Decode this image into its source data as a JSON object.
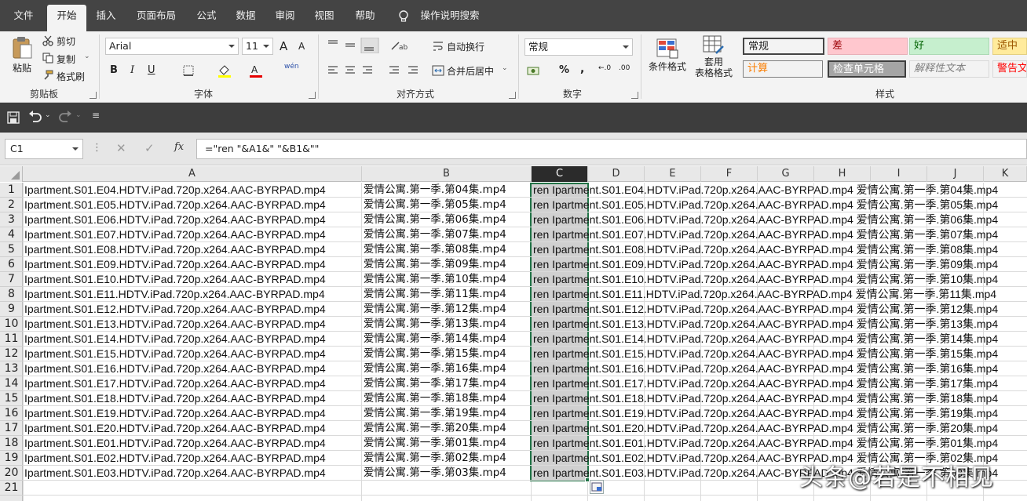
{
  "menu": {
    "tabs": [
      {
        "label": "文件",
        "x": 0
      },
      {
        "label": "开始",
        "x": 0
      },
      {
        "label": "插入",
        "x": 0
      },
      {
        "label": "页面布局",
        "x": 0
      },
      {
        "label": "公式",
        "x": 0
      },
      {
        "label": "数据",
        "x": 0
      },
      {
        "label": "审阅",
        "x": 0
      },
      {
        "label": "视图",
        "x": 0
      },
      {
        "label": "帮助",
        "x": 0
      }
    ],
    "active_tab": "开始",
    "tell_me": "操作说明搜索"
  },
  "ribbon": {
    "clipboard": {
      "paste": "粘贴",
      "cut": "剪切",
      "copy": "复制",
      "format_painter": "格式刷",
      "group_label": "剪贴板"
    },
    "font": {
      "font_name": "Arial",
      "font_size": "11",
      "bold": "B",
      "italic": "I",
      "underline": "U",
      "group_label": "字体",
      "phonetic": "wén",
      "grow": "A",
      "shrink": "A"
    },
    "alignment": {
      "wrap_text": "自动换行",
      "merge_center": "合并后居中",
      "group_label": "对齐方式"
    },
    "number": {
      "format": "常规",
      "percent": "%",
      "comma": ",",
      "inc_decimal": "←.0",
      "dec_decimal": ".00",
      "group_label": "数字"
    },
    "styles": {
      "conditional_format": "条件格式",
      "table_format_1": "套用",
      "table_format_2": "表格格式",
      "group_label": "样式",
      "cells": [
        {
          "label": "常规",
          "bg": "#ffffff",
          "color": "#111111"
        },
        {
          "label": "差",
          "bg": "#ffc7ce",
          "color": "#9c0006"
        },
        {
          "label": "好",
          "bg": "#c6efce",
          "color": "#006100"
        },
        {
          "label": "适中",
          "bg": "#ffeb9c",
          "color": "#9c5700"
        },
        {
          "label": "计算",
          "bg": "#f2f2f2",
          "color": "#fa7d00"
        },
        {
          "label": "检查单元格",
          "bg": "#a5a5a5",
          "color": "#ffffff"
        },
        {
          "label": "解释性文本",
          "bg": "#ffffff",
          "color": "#7f7f7f"
        },
        {
          "label": "警告文",
          "bg": "#ffffff",
          "color": "#ff0000"
        }
      ]
    }
  },
  "formula_bar": {
    "name_box": "C1",
    "fx": "fx",
    "formula": "=\"ren \"&A1&\" \"&B1&\"\""
  },
  "grid": {
    "columns": [
      "A",
      "B",
      "C",
      "D",
      "E",
      "F",
      "G",
      "H",
      "I",
      "J",
      "K"
    ],
    "selected_column": "C",
    "rows": [
      {
        "n": "1",
        "a": "Ipartment.S01.E04.HDTV.iPad.720p.x264.AAC-BYRPAD.mp4",
        "b": "爱情公寓.第一季.第04集.mp4",
        "c": "ren Ipartment.S01.E04.HDTV.iPad.720p.x264.AAC-BYRPAD.mp4 爱情公寓.第一季.第04集.mp4"
      },
      {
        "n": "2",
        "a": "Ipartment.S01.E05.HDTV.iPad.720p.x264.AAC-BYRPAD.mp4",
        "b": "爱情公寓.第一季.第05集.mp4",
        "c": "ren Ipartment.S01.E05.HDTV.iPad.720p.x264.AAC-BYRPAD.mp4 爱情公寓.第一季.第05集.mp4"
      },
      {
        "n": "3",
        "a": "Ipartment.S01.E06.HDTV.iPad.720p.x264.AAC-BYRPAD.mp4",
        "b": "爱情公寓.第一季.第06集.mp4",
        "c": "ren Ipartment.S01.E06.HDTV.iPad.720p.x264.AAC-BYRPAD.mp4 爱情公寓.第一季.第06集.mp4"
      },
      {
        "n": "4",
        "a": "Ipartment.S01.E07.HDTV.iPad.720p.x264.AAC-BYRPAD.mp4",
        "b": "爱情公寓.第一季.第07集.mp4",
        "c": "ren Ipartment.S01.E07.HDTV.iPad.720p.x264.AAC-BYRPAD.mp4 爱情公寓.第一季.第07集.mp4"
      },
      {
        "n": "5",
        "a": "Ipartment.S01.E08.HDTV.iPad.720p.x264.AAC-BYRPAD.mp4",
        "b": "爱情公寓.第一季.第08集.mp4",
        "c": "ren Ipartment.S01.E08.HDTV.iPad.720p.x264.AAC-BYRPAD.mp4 爱情公寓.第一季.第08集.mp4"
      },
      {
        "n": "6",
        "a": "Ipartment.S01.E09.HDTV.iPad.720p.x264.AAC-BYRPAD.mp4",
        "b": "爱情公寓.第一季.第09集.mp4",
        "c": "ren Ipartment.S01.E09.HDTV.iPad.720p.x264.AAC-BYRPAD.mp4 爱情公寓.第一季.第09集.mp4"
      },
      {
        "n": "7",
        "a": "Ipartment.S01.E10.HDTV.iPad.720p.x264.AAC-BYRPAD.mp4",
        "b": "爱情公寓.第一季.第10集.mp4",
        "c": "ren Ipartment.S01.E10.HDTV.iPad.720p.x264.AAC-BYRPAD.mp4 爱情公寓.第一季.第10集.mp4"
      },
      {
        "n": "8",
        "a": "Ipartment.S01.E11.HDTV.iPad.720p.x264.AAC-BYRPAD.mp4",
        "b": "爱情公寓.第一季.第11集.mp4",
        "c": "ren Ipartment.S01.E11.HDTV.iPad.720p.x264.AAC-BYRPAD.mp4 爱情公寓.第一季.第11集.mp4"
      },
      {
        "n": "9",
        "a": "Ipartment.S01.E12.HDTV.iPad.720p.x264.AAC-BYRPAD.mp4",
        "b": "爱情公寓.第一季.第12集.mp4",
        "c": "ren Ipartment.S01.E12.HDTV.iPad.720p.x264.AAC-BYRPAD.mp4 爱情公寓.第一季.第12集.mp4"
      },
      {
        "n": "10",
        "a": "Ipartment.S01.E13.HDTV.iPad.720p.x264.AAC-BYRPAD.mp4",
        "b": "爱情公寓.第一季.第13集.mp4",
        "c": "ren Ipartment.S01.E13.HDTV.iPad.720p.x264.AAC-BYRPAD.mp4 爱情公寓.第一季.第13集.mp4"
      },
      {
        "n": "11",
        "a": "Ipartment.S01.E14.HDTV.iPad.720p.x264.AAC-BYRPAD.mp4",
        "b": "爱情公寓.第一季.第14集.mp4",
        "c": "ren Ipartment.S01.E14.HDTV.iPad.720p.x264.AAC-BYRPAD.mp4 爱情公寓.第一季.第14集.mp4"
      },
      {
        "n": "12",
        "a": "Ipartment.S01.E15.HDTV.iPad.720p.x264.AAC-BYRPAD.mp4",
        "b": "爱情公寓.第一季.第15集.mp4",
        "c": "ren Ipartment.S01.E15.HDTV.iPad.720p.x264.AAC-BYRPAD.mp4 爱情公寓.第一季.第15集.mp4"
      },
      {
        "n": "13",
        "a": "Ipartment.S01.E16.HDTV.iPad.720p.x264.AAC-BYRPAD.mp4",
        "b": "爱情公寓.第一季.第16集.mp4",
        "c": "ren Ipartment.S01.E16.HDTV.iPad.720p.x264.AAC-BYRPAD.mp4 爱情公寓.第一季.第16集.mp4"
      },
      {
        "n": "14",
        "a": "Ipartment.S01.E17.HDTV.iPad.720p.x264.AAC-BYRPAD.mp4",
        "b": "爱情公寓.第一季.第17集.mp4",
        "c": "ren Ipartment.S01.E17.HDTV.iPad.720p.x264.AAC-BYRPAD.mp4 爱情公寓.第一季.第17集.mp4"
      },
      {
        "n": "15",
        "a": "Ipartment.S01.E18.HDTV.iPad.720p.x264.AAC-BYRPAD.mp4",
        "b": "爱情公寓.第一季.第18集.mp4",
        "c": "ren Ipartment.S01.E18.HDTV.iPad.720p.x264.AAC-BYRPAD.mp4 爱情公寓.第一季.第18集.mp4"
      },
      {
        "n": "16",
        "a": "Ipartment.S01.E19.HDTV.iPad.720p.x264.AAC-BYRPAD.mp4",
        "b": "爱情公寓.第一季.第19集.mp4",
        "c": "ren Ipartment.S01.E19.HDTV.iPad.720p.x264.AAC-BYRPAD.mp4 爱情公寓.第一季.第19集.mp4"
      },
      {
        "n": "17",
        "a": "Ipartment.S01.E20.HDTV.iPad.720p.x264.AAC-BYRPAD.mp4",
        "b": "爱情公寓.第一季.第20集.mp4",
        "c": "ren Ipartment.S01.E20.HDTV.iPad.720p.x264.AAC-BYRPAD.mp4 爱情公寓.第一季.第20集.mp4"
      },
      {
        "n": "18",
        "a": "Ipartment.S01.E01.HDTV.iPad.720p.x264.AAC-BYRPAD.mp4",
        "b": "爱情公寓.第一季.第01集.mp4",
        "c": "ren Ipartment.S01.E01.HDTV.iPad.720p.x264.AAC-BYRPAD.mp4 爱情公寓.第一季.第01集.mp4"
      },
      {
        "n": "19",
        "a": "Ipartment.S01.E02.HDTV.iPad.720p.x264.AAC-BYRPAD.mp4",
        "b": "爱情公寓.第一季.第02集.mp4",
        "c": "ren Ipartment.S01.E02.HDTV.iPad.720p.x264.AAC-BYRPAD.mp4 爱情公寓.第一季.第02集.mp4"
      },
      {
        "n": "20",
        "a": "Ipartment.S01.E03.HDTV.iPad.720p.x264.AAC-BYRPAD.mp4",
        "b": "爱情公寓.第一季.第03集.mp4",
        "c": "ren Ipartment.S01.E03.HDTV.iPad.720p.x264.AAC-BYRPAD.mp4 爱情公寓.第一季.第03集.mp4"
      },
      {
        "n": "21",
        "a": "",
        "b": "",
        "c": ""
      }
    ]
  },
  "watermark": "头条@若是不相见",
  "colors": {
    "accent": "#217346",
    "menubar": "#444444",
    "ribbon": "#f3f3f3"
  }
}
